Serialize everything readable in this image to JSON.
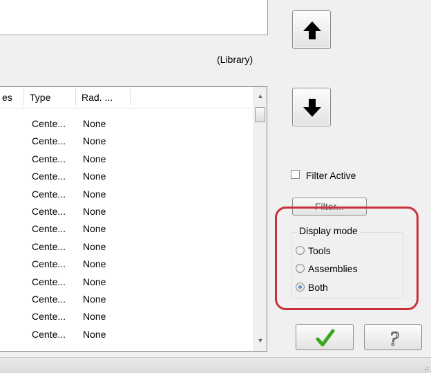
{
  "library_label": "(Library)",
  "list": {
    "columns": [
      "es",
      "Type",
      "Rad. ..."
    ],
    "rows": [
      {
        "type": "Cente...",
        "rad": "None"
      },
      {
        "type": "Cente...",
        "rad": "None"
      },
      {
        "type": "Cente...",
        "rad": "None"
      },
      {
        "type": "Cente...",
        "rad": "None"
      },
      {
        "type": "Cente...",
        "rad": "None"
      },
      {
        "type": "Cente...",
        "rad": "None"
      },
      {
        "type": "Cente...",
        "rad": "None"
      },
      {
        "type": "Cente...",
        "rad": "None"
      },
      {
        "type": "Cente...",
        "rad": "None"
      },
      {
        "type": "Cente...",
        "rad": "None"
      },
      {
        "type": "Cente...",
        "rad": "None"
      },
      {
        "type": "Cente...",
        "rad": "None"
      },
      {
        "type": "Cente...",
        "rad": "None"
      }
    ]
  },
  "buttons": {
    "move_up_icon": "arrow-up-icon",
    "move_down_icon": "arrow-down-icon",
    "filter_label": "Filter...",
    "ok_icon": "checkmark-icon",
    "help_icon": "question-mark-icon"
  },
  "filter_active": {
    "label": "Filter Active",
    "checked": false
  },
  "display_mode": {
    "title": "Display mode",
    "options": [
      {
        "label": "Tools",
        "selected": false
      },
      {
        "label": "Assemblies",
        "selected": false
      },
      {
        "label": "Both",
        "selected": true
      }
    ]
  },
  "colors": {
    "highlight": "#c8303c",
    "ok_check": "#3aa81e",
    "radio_selected": "#1a5fb4"
  }
}
